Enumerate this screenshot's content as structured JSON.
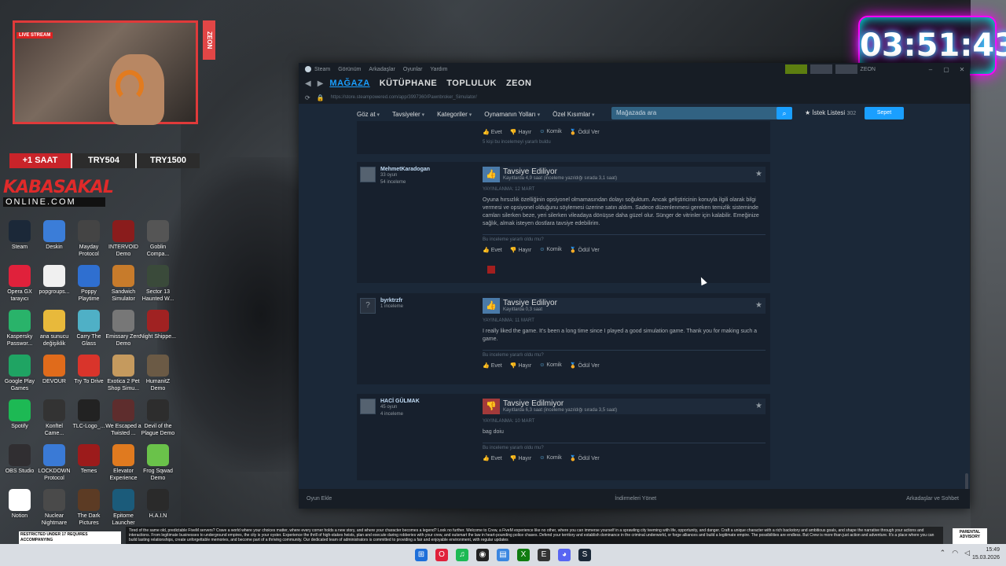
{
  "stream": {
    "live_label": "LIVE STREAM",
    "zeon_side": "ZEON",
    "ticker": [
      "+1 SAAT",
      "TRY504",
      "TRY1500"
    ],
    "brand_line1": "KABASAKAL",
    "brand_line2": "ONLINE.COM",
    "timer": "03:51:43"
  },
  "desktop_icons": [
    {
      "label": "Steam",
      "icon": "steam-icon",
      "color": "#1b2838"
    },
    {
      "label": "Deskin",
      "icon": "deskin-icon",
      "color": "#3b7dd8"
    },
    {
      "label": "Mayday Protocol",
      "icon": "mayday-icon",
      "color": "#444"
    },
    {
      "label": "INTERVOID Demo",
      "icon": "intervoid-icon",
      "color": "#8a1c1c"
    },
    {
      "label": "Goblin Compa...",
      "icon": "goblin-icon",
      "color": "#555"
    },
    {
      "label": "Opera GX tarayıcı",
      "icon": "opera-icon",
      "color": "#e0213b"
    },
    {
      "label": "popgroups...",
      "icon": "file-icon",
      "color": "#f0f0f0"
    },
    {
      "label": "Poppy Playtime",
      "icon": "poppy-icon",
      "color": "#2f6fd0"
    },
    {
      "label": "Sandwich Simulator",
      "icon": "sandwich-icon",
      "color": "#c77b2b"
    },
    {
      "label": "Sector 13 Haunted W...",
      "icon": "sector-icon",
      "color": "#3a4a3a"
    },
    {
      "label": "Kaspersky Passwor...",
      "icon": "kaspersky-icon",
      "color": "#29b36a"
    },
    {
      "label": "ana sunucu değişiklik",
      "icon": "folder-icon",
      "color": "#e8b93b"
    },
    {
      "label": "Carry The Glass",
      "icon": "carry-icon",
      "color": "#4fb0c6"
    },
    {
      "label": "Emissary Zero Demo",
      "icon": "emissary-icon",
      "color": "#777"
    },
    {
      "label": "Night Shippe...",
      "icon": "night-icon",
      "color": "#a02222"
    },
    {
      "label": "Google Play Games",
      "icon": "play-icon",
      "color": "#1fa463"
    },
    {
      "label": "DEVOUR",
      "icon": "devour-icon",
      "color": "#e06b1b"
    },
    {
      "label": "Try To Drive",
      "icon": "drive-icon",
      "color": "#d9342b"
    },
    {
      "label": "Exotica 2 Pet Shop Simu...",
      "icon": "pet-icon",
      "color": "#c59a5e"
    },
    {
      "label": "HumanitZ Demo",
      "icon": "humanitz-icon",
      "color": "#6b5a45"
    },
    {
      "label": "Spotify",
      "icon": "spotify-icon",
      "color": "#1db954"
    },
    {
      "label": "Konftel Came...",
      "icon": "konftel-icon",
      "color": "#333"
    },
    {
      "label": "TLC-Logo_...",
      "icon": "tlc-icon",
      "color": "#222"
    },
    {
      "label": "We Escaped a Twisted ...",
      "icon": "escaped-icon",
      "color": "#5e2d2d"
    },
    {
      "label": "Devil of the Plague Demo",
      "icon": "devil-icon",
      "color": "#2d2d2d"
    },
    {
      "label": "OBS Studio",
      "icon": "obs-icon",
      "color": "#302e31"
    },
    {
      "label": "LOCKDOWN Protocol",
      "icon": "lockdown-icon",
      "color": "#3a7ad6"
    },
    {
      "label": "Temes",
      "icon": "temes-icon",
      "color": "#9c1b1b"
    },
    {
      "label": "Elevator Experience",
      "icon": "elevator-icon",
      "color": "#e07a1f"
    },
    {
      "label": "Frog Sqwad Demo",
      "icon": "frog-icon",
      "color": "#6ac24a"
    },
    {
      "label": "Notion",
      "icon": "notion-icon",
      "color": "#ffffff"
    },
    {
      "label": "Nuclear Nightmare",
      "icon": "nuclear-icon",
      "color": "#4a4a4a"
    },
    {
      "label": "The Dark Pictures",
      "icon": "dark-icon",
      "color": "#5c3b24"
    },
    {
      "label": "Epitome Launcher",
      "icon": "epitome-icon",
      "color": "#1b5b7a"
    },
    {
      "label": "H.A.I.N",
      "icon": "hain-icon",
      "color": "#2a2a2a"
    }
  ],
  "steam": {
    "titlebar": [
      "Steam",
      "Görünüm",
      "Arkadaşlar",
      "Oyunlar",
      "Yardım"
    ],
    "user": "ZEON",
    "tabs": [
      "MAĞAZA",
      "KÜTÜPHANE",
      "TOPLULUK",
      "ZEON"
    ],
    "url": "https://store.steampowered.com/app/3997360/Pawnbroker_Simulator/",
    "store_nav": [
      "Göz at",
      "Tavsiyeler",
      "Kategoriler",
      "Oynamanın Yolları",
      "Özel Kısımlar"
    ],
    "search_placeholder": "Mağazada ara",
    "wishlist_label": "İstek Listesi",
    "wishlist_count": "302",
    "cart_label": "Sepet",
    "prev_votes": [
      "Evet",
      "Hayır",
      "Komik",
      "Ödül Ver"
    ],
    "prev_helpful_count": "5 kişi bu incelemeyi yararlı buldu",
    "reviews": [
      {
        "author": "MehmetKaradogan",
        "games": "33 oyun",
        "reviews_count": "54 inceleme",
        "verdict": "Tavsiye Ediliyor",
        "recommended": true,
        "hours": "Kayıtlarda 4,9 saat (inceleme yazıldığı sırada 3,1 saat)",
        "posted": "YAYINLANMA: 12 MART",
        "text": "Oyuna hırsızlık özelliğinin opsiyonel olmamasından dolayı soğuktum. Ancak geliştiricinin konuyla ilgili olarak bilgi vermesi ve opsiyonel olduğunu söylemesi üzerine satın aldım. Sadece düzenlenmesi gereken temizlik sisteminde camları silerken beze, yeri silerken vileadaya dönüşse daha güzel olur. Sünger de vitrinler için kalabilir. Emeğinize sağlık, almak isteyen dostlara tavsiye edebilirim.",
        "helpful_q": "Bu inceleme yararlı oldu mu?",
        "votes": [
          "Evet",
          "Hayır",
          "Komik",
          "Ödül Ver"
        ]
      },
      {
        "author": "byrktrzfr",
        "games": "",
        "reviews_count": "1 inceleme",
        "verdict": "Tavsiye Ediliyor",
        "recommended": true,
        "hours": "Kayıtlarda 0,3 saat",
        "posted": "YAYINLANMA: 11 MART",
        "text": "I really liked the game. It's been a long time since I played a good simulation game. Thank you for making such a game.",
        "helpful_q": "Bu inceleme yararlı oldu mu?",
        "votes": [
          "Evet",
          "Hayır",
          "Komik",
          "Ödül Ver"
        ]
      },
      {
        "author": "HACİ GÜLMAK",
        "games": "45 oyun",
        "reviews_count": "4 inceleme",
        "verdict": "Tavsiye Edilmiyor",
        "recommended": false,
        "hours": "Kayıtlarda 6,3 saat (inceleme yazıldığı sırada 3,5 saat)",
        "posted": "YAYINLANMA: 10 MART",
        "text": "bag doiu",
        "helpful_q": "Bu inceleme yararlı oldu mu?",
        "votes": [
          "Evet",
          "Hayır",
          "Komik",
          "Ödül Ver"
        ]
      }
    ],
    "bottom": [
      "Oyun Ekle",
      "İndirmeleri Yönet",
      "Arkadaşlar ve Sohbet"
    ]
  },
  "overlay": {
    "ad_text": "Tired of the same old, predictable FiveM servers? Crave a world where your choices matter, where every corner holds a new story, and where your character becomes a legend? Look no further. Welcome to Crew, a FiveM experience like no other, where you can immerse yourself in a sprawling city teeming with life, opportunity, and danger. Craft a unique character with a rich backstory and ambitious goals, and shape the narrative through your actions and interactions. From legitimate businesses to underground empires, the city is your oyster. Experience the thrill of high-stakes heists, plan and execute daring robberies with your crew, and outsmart the law in heart-pounding police chases. Defend your territory and establish dominance in the criminal underworld, or forge alliances and build a legitimate empire. The possibilities are endless. But Crew is more than just action and adventure. It's a place where you can build lasting relationships, create unforgettable memories, and become part of a thriving community. Our dedicated team of administrators is committed to providing a fair and enjoyable environment, with regular updates",
    "advisory": "PARENTAL ADVISORY",
    "rated": "RESTRICTED UNDER 17 REQUIRES ACCOMPANYING"
  },
  "taskbar": {
    "time": "15:49",
    "date": "15.03.2026"
  }
}
